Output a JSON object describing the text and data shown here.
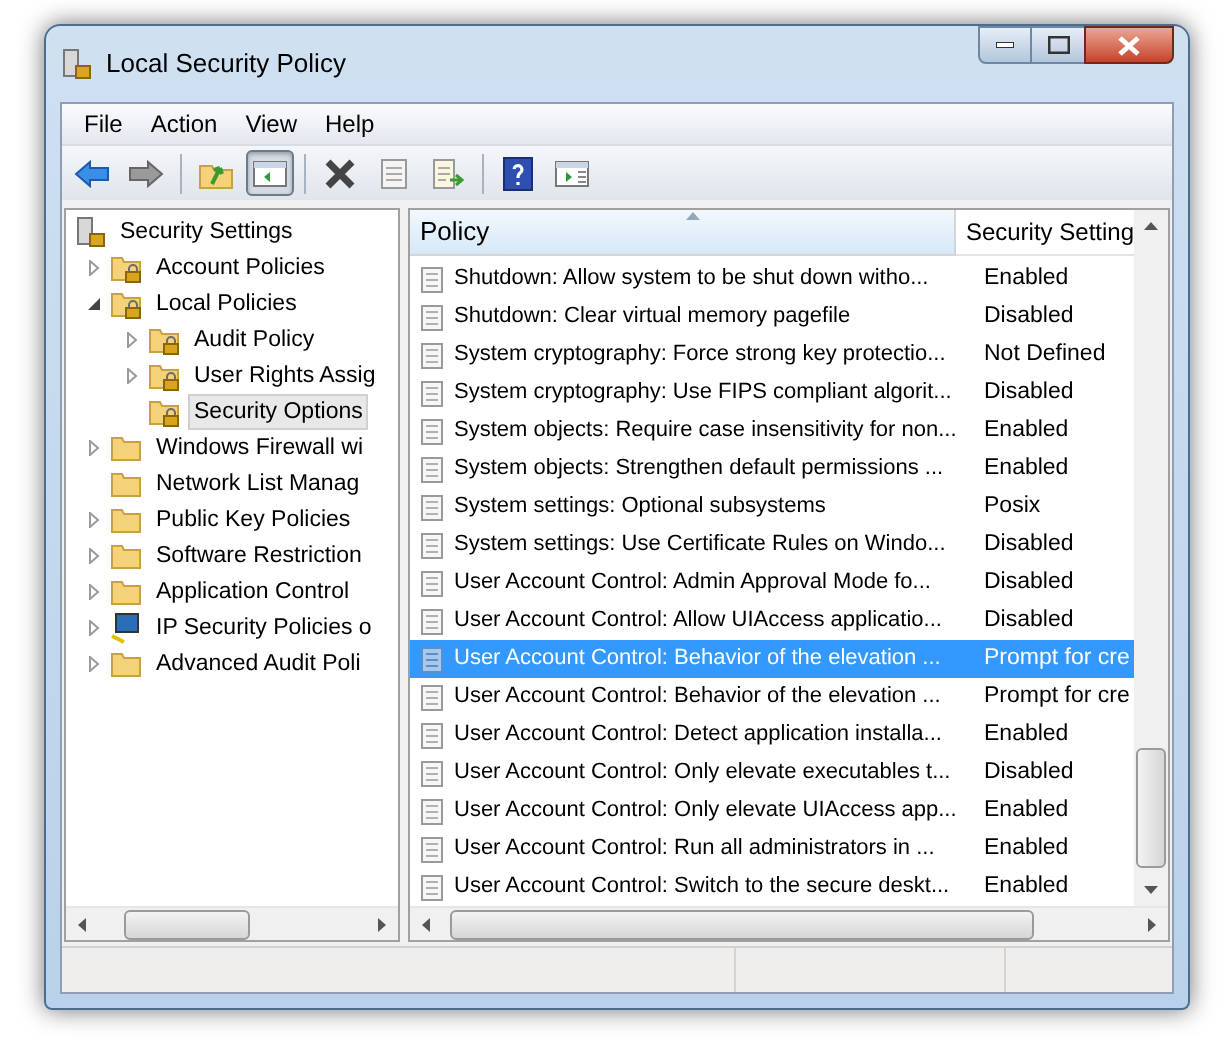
{
  "window": {
    "title": "Local Security Policy"
  },
  "menu": [
    "File",
    "Action",
    "View",
    "Help"
  ],
  "toolbar": [
    {
      "kind": "back",
      "pressed": false
    },
    {
      "kind": "forward",
      "pressed": false
    },
    {
      "kind": "sep"
    },
    {
      "kind": "up",
      "pressed": false
    },
    {
      "kind": "tree",
      "pressed": true
    },
    {
      "kind": "sep"
    },
    {
      "kind": "delete",
      "pressed": false
    },
    {
      "kind": "properties",
      "pressed": false
    },
    {
      "kind": "export",
      "pressed": false
    },
    {
      "kind": "sep"
    },
    {
      "kind": "help",
      "pressed": false
    },
    {
      "kind": "pane",
      "pressed": false
    }
  ],
  "tree": [
    {
      "label": "Security Settings",
      "kind": "server",
      "expandable": false,
      "selected": false,
      "children": [
        {
          "label": "Account Policies",
          "kind": "locked-folder",
          "expandable": true,
          "expanded": false,
          "selected": false
        },
        {
          "label": "Local Policies",
          "kind": "locked-folder",
          "expandable": true,
          "expanded": true,
          "selected": false,
          "children": [
            {
              "label": "Audit Policy",
              "kind": "locked-folder",
              "expandable": true,
              "expanded": false,
              "selected": false
            },
            {
              "label": "User Rights Assig",
              "kind": "locked-folder",
              "expandable": true,
              "expanded": false,
              "selected": false
            },
            {
              "label": "Security Options",
              "kind": "locked-folder",
              "expandable": false,
              "selected": true
            }
          ]
        },
        {
          "label": "Windows Firewall wi",
          "kind": "folder",
          "expandable": true,
          "expanded": false,
          "selected": false
        },
        {
          "label": "Network List Manag",
          "kind": "folder",
          "expandable": false,
          "selected": false
        },
        {
          "label": "Public Key Policies",
          "kind": "folder",
          "expandable": true,
          "expanded": false,
          "selected": false
        },
        {
          "label": "Software Restriction",
          "kind": "folder",
          "expandable": true,
          "expanded": false,
          "selected": false
        },
        {
          "label": "Application Control",
          "kind": "folder",
          "expandable": true,
          "expanded": false,
          "selected": false
        },
        {
          "label": "IP Security Policies o",
          "kind": "computer",
          "expandable": true,
          "expanded": false,
          "selected": false
        },
        {
          "label": "Advanced Audit Poli",
          "kind": "folder",
          "expandable": true,
          "expanded": false,
          "selected": false
        }
      ]
    }
  ],
  "table": {
    "columns": [
      "Policy",
      "Security Setting"
    ],
    "rows": [
      {
        "policy": "Shutdown: Allow system to be shut down witho...",
        "setting": "Enabled",
        "selected": false
      },
      {
        "policy": "Shutdown: Clear virtual memory pagefile",
        "setting": "Disabled",
        "selected": false
      },
      {
        "policy": "System cryptography: Force strong key protectio...",
        "setting": "Not Defined",
        "selected": false
      },
      {
        "policy": "System cryptography: Use FIPS compliant algorit...",
        "setting": "Disabled",
        "selected": false
      },
      {
        "policy": "System objects: Require case insensitivity for non...",
        "setting": "Enabled",
        "selected": false
      },
      {
        "policy": "System objects: Strengthen default permissions ...",
        "setting": "Enabled",
        "selected": false
      },
      {
        "policy": "System settings: Optional subsystems",
        "setting": "Posix",
        "selected": false
      },
      {
        "policy": "System settings: Use Certificate Rules on Windo...",
        "setting": "Disabled",
        "selected": false
      },
      {
        "policy": "User Account Control: Admin Approval Mode fo...",
        "setting": "Disabled",
        "selected": false
      },
      {
        "policy": "User Account Control: Allow UIAccess applicatio...",
        "setting": "Disabled",
        "selected": false
      },
      {
        "policy": "User Account Control: Behavior of the elevation ...",
        "setting": "Prompt for cre",
        "selected": true
      },
      {
        "policy": "User Account Control: Behavior of the elevation ...",
        "setting": "Prompt for cre",
        "selected": false
      },
      {
        "policy": "User Account Control: Detect application installa...",
        "setting": "Enabled",
        "selected": false
      },
      {
        "policy": "User Account Control: Only elevate executables t...",
        "setting": "Disabled",
        "selected": false
      },
      {
        "policy": "User Account Control: Only elevate UIAccess app...",
        "setting": "Enabled",
        "selected": false
      },
      {
        "policy": "User Account Control: Run all administrators in ...",
        "setting": "Enabled",
        "selected": false
      },
      {
        "policy": "User Account Control: Switch to the secure deskt...",
        "setting": "Enabled",
        "selected": false
      }
    ]
  }
}
